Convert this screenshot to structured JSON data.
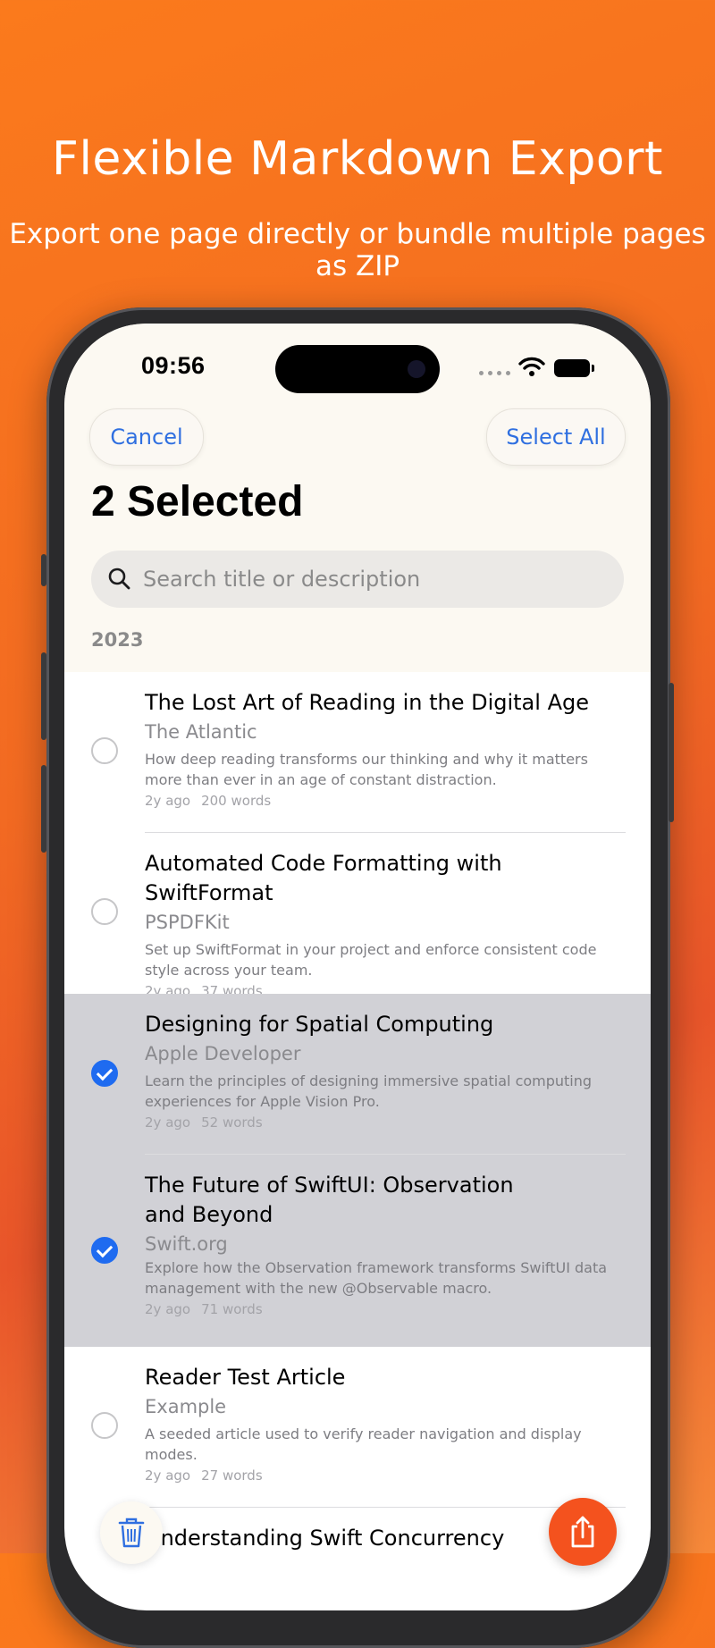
{
  "promo": {
    "title": "Flexible Markdown Export",
    "subtitle": "Export one page directly or bundle multiple pages as ZIP"
  },
  "status_bar": {
    "time": "09:56"
  },
  "nav": {
    "cancel_label": "Cancel",
    "select_all_label": "Select All",
    "title": "2 Selected"
  },
  "search": {
    "placeholder": "Search title or description",
    "value": ""
  },
  "section": {
    "header": "2023"
  },
  "articles": [
    {
      "title": "The Lost Art of Reading in the Digital Age",
      "source": "The Atlantic",
      "description": "How deep reading transforms our thinking and why it matters more than ever in an age of constant distraction.",
      "age": "2y ago",
      "words": "200 words",
      "selected": false
    },
    {
      "title": "Automated Code Formatting with SwiftFormat",
      "source": "PSPDFKit",
      "description": "Set up SwiftFormat in your project and enforce consistent code style across your team.",
      "age": "2y ago",
      "words": "37 words",
      "selected": false
    },
    {
      "title": "Designing for Spatial Computing",
      "source": "Apple Developer",
      "description": "Learn the principles of designing immersive spatial computing experiences for Apple Vision Pro.",
      "age": "2y ago",
      "words": "52 words",
      "selected": true
    },
    {
      "title": "The Future of SwiftUI: Observation and Beyond",
      "source": "Swift.org",
      "description": "Explore how the Observation framework transforms SwiftUI data management with the new @Observable macro.",
      "age": "2y ago",
      "words": "71 words",
      "selected": true
    },
    {
      "title": "Reader Test Article",
      "source": "Example",
      "description": "A seeded article used to verify reader navigation and display modes.",
      "age": "2y ago",
      "words": "27 words",
      "selected": false
    },
    {
      "title": "Understanding Swift Concurrency",
      "source": "",
      "description": "",
      "age": "",
      "words": "",
      "selected": false
    }
  ],
  "actions": {
    "delete_icon": "trash-icon",
    "share_icon": "share-icon"
  },
  "colors": {
    "accent": "#2f6fe0",
    "selected_row": "#d1d1d6",
    "share_button": "#f4521e",
    "checkbox_on": "#1f6bf0"
  }
}
